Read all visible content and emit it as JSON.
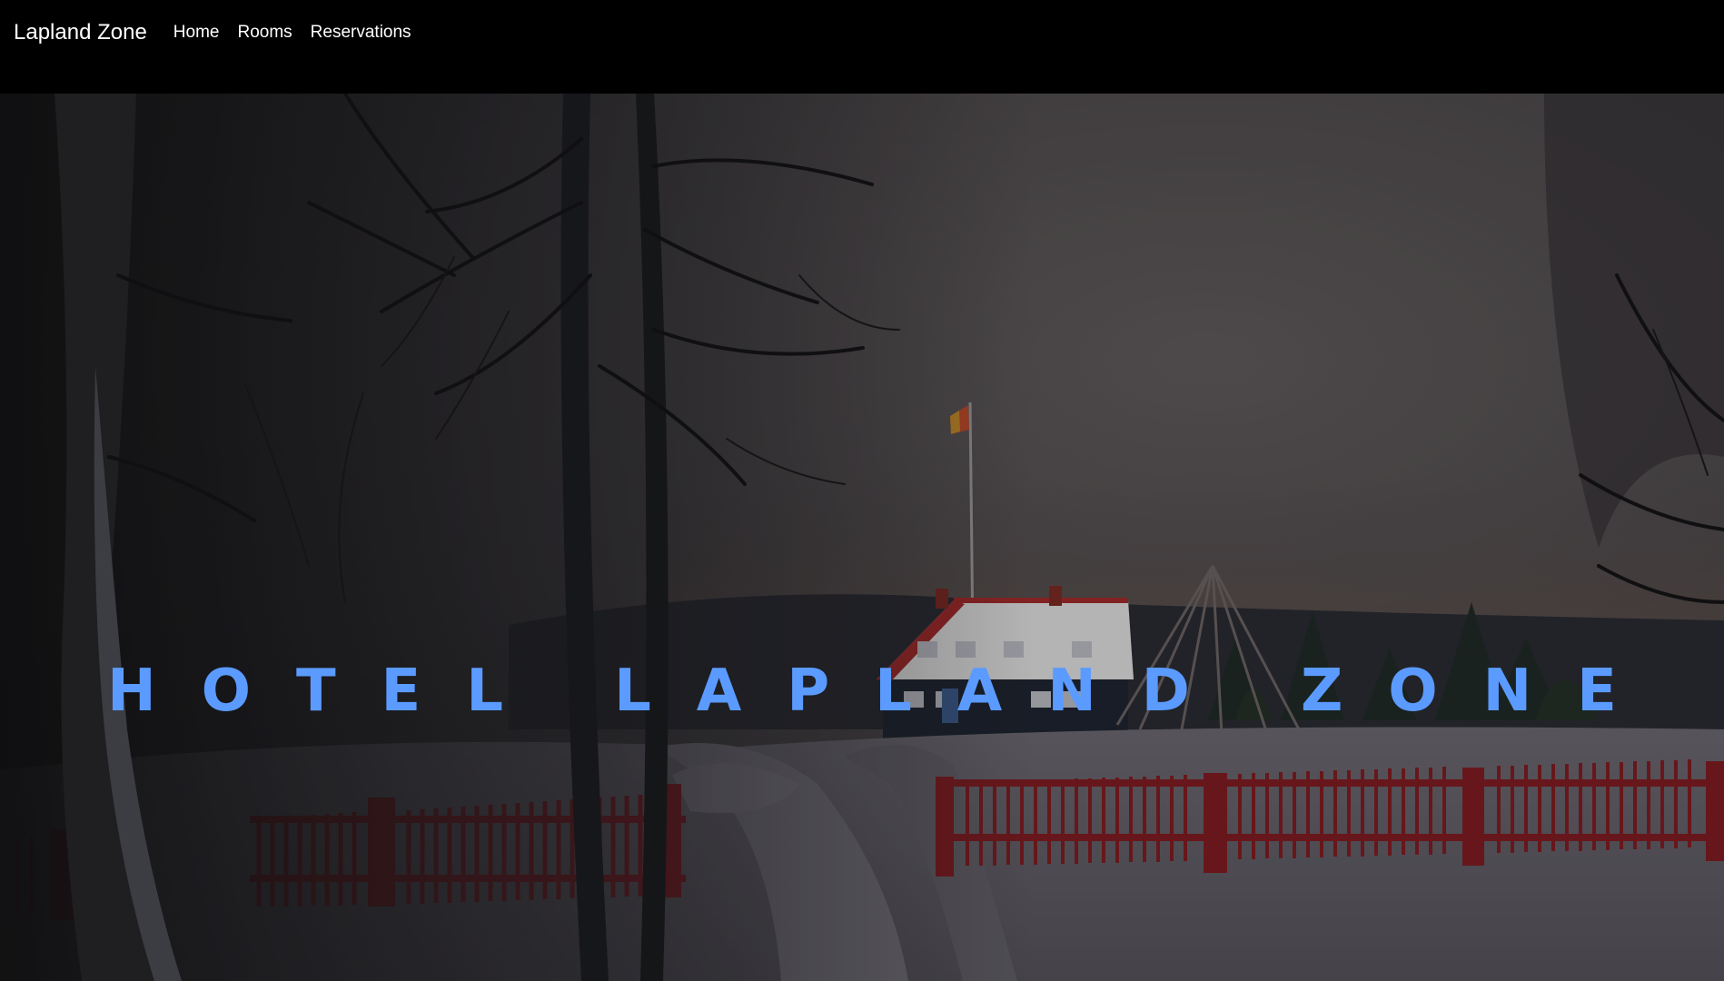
{
  "navbar": {
    "brand": "Lapland Zone",
    "links": [
      {
        "label": "Home"
      },
      {
        "label": "Rooms"
      },
      {
        "label": "Reservations"
      }
    ]
  },
  "hero": {
    "title": "HOTEL LAPLAND ZONE",
    "title_color": "#5b9bff",
    "image": "winter lodge with red fence, birch trees and snowy path at dusk (dimmed)"
  },
  "colors": {
    "navbar_bg": "#000000",
    "nav_text": "#ffffff",
    "fence": "#8a1f25"
  }
}
